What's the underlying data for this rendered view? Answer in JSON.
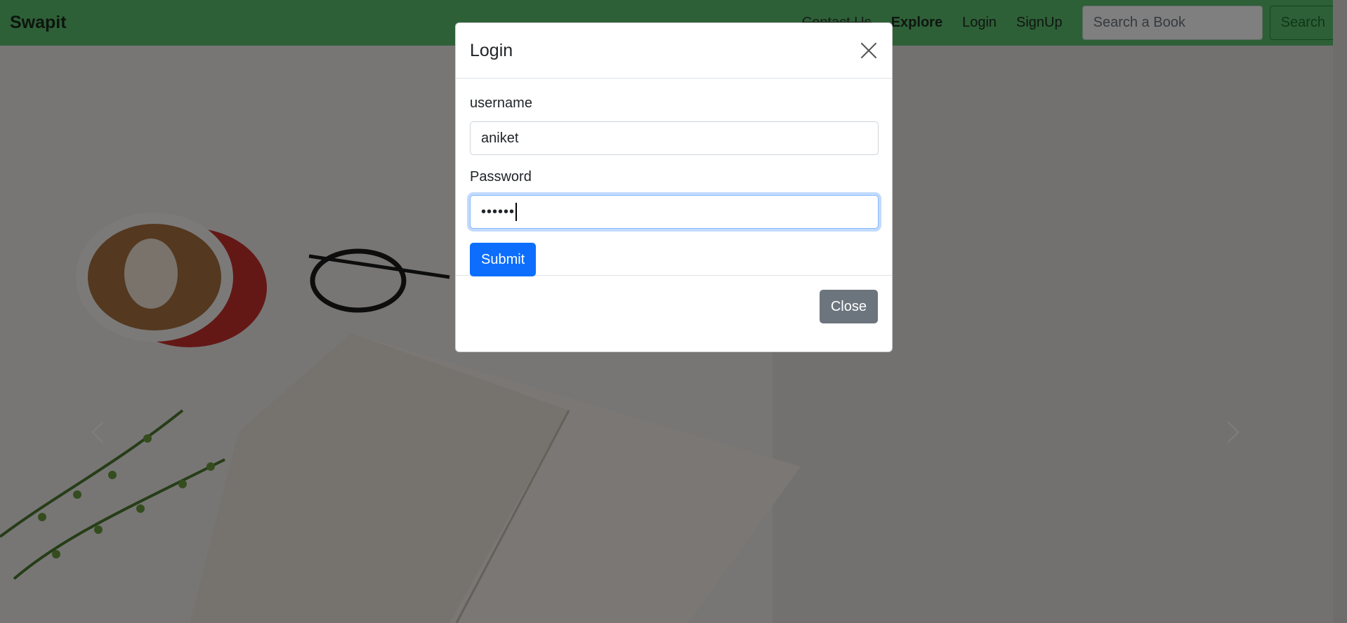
{
  "navbar": {
    "brand": "Swapit",
    "links": [
      "Contact Us",
      "Explore",
      "Login",
      "SignUp"
    ],
    "search_placeholder": "Search a Book",
    "search_button": "Search"
  },
  "modal": {
    "title": "Login",
    "username_label": "username",
    "username_value": "aniket",
    "password_label": "Password",
    "password_mask": "••••••",
    "submit_label": "Submit",
    "close_label": "Close"
  },
  "colors": {
    "navbar": "#5cc06f",
    "primary": "#0d6efd",
    "secondary": "#6c757d"
  }
}
